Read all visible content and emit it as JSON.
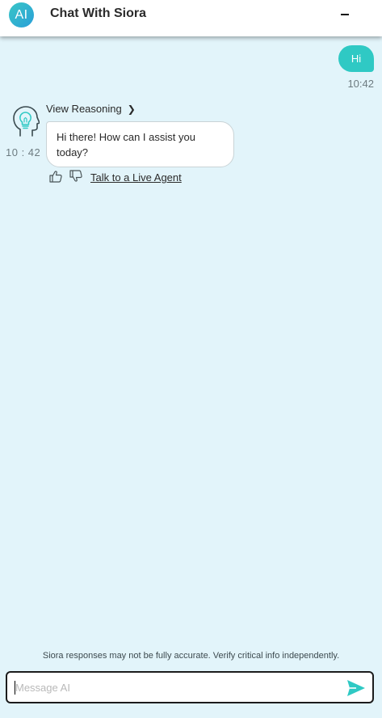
{
  "header": {
    "logo_text": "AI",
    "title": "Chat With Siora",
    "minimize_icon": "minimize-icon"
  },
  "messages": [
    {
      "role": "user",
      "text": "Hi",
      "time": "10:42"
    },
    {
      "role": "assistant",
      "avatar_icon": "head-lightbulb-icon",
      "view_reasoning_label": "View Reasoning",
      "text": "Hi there! How can I assist you today?",
      "time": "10 : 42",
      "feedback_icons": [
        "thumbs-up-icon",
        "thumbs-down-icon"
      ],
      "live_agent_label": "Talk to a Live Agent"
    }
  ],
  "footer": {
    "disclaimer": "Siora responses may not be fully accurate. Verify critical info independently.",
    "input_placeholder": "Message AI",
    "input_value": "",
    "send_icon": "send-icon"
  },
  "colors": {
    "background": "#e2f4fa",
    "accent": "#2fc9c4",
    "header_bg": "#ffffff"
  }
}
